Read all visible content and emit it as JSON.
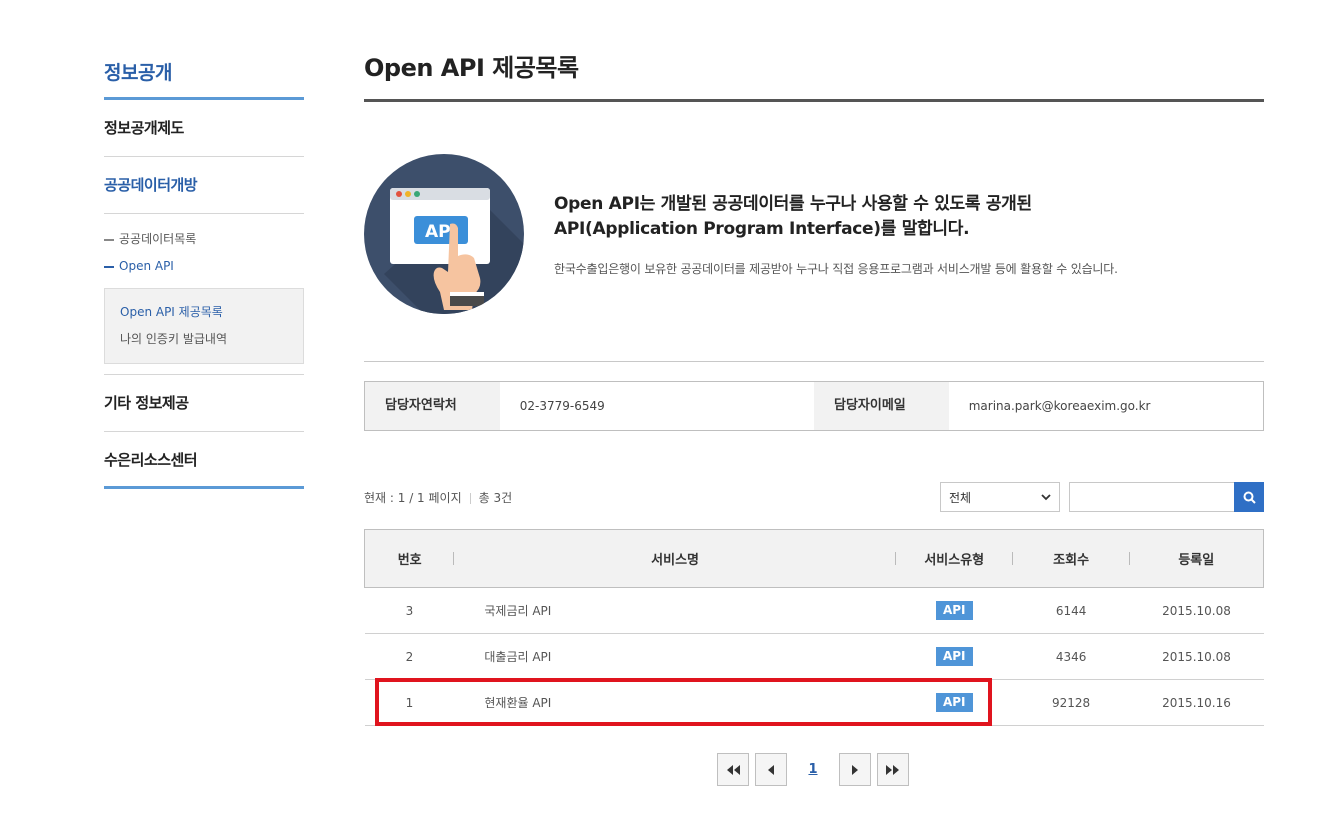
{
  "sidebar": {
    "title": "정보공개",
    "items": [
      {
        "label": "정보공개제도"
      },
      {
        "label": "공공데이터개방"
      },
      {
        "label": "기타 정보제공"
      },
      {
        "label": "수은리소스센터"
      }
    ],
    "sub_items": [
      {
        "label": "공공데이터목록"
      },
      {
        "label": "Open API"
      }
    ],
    "box_items": [
      {
        "label": "Open API 제공목록"
      },
      {
        "label": "나의 인증키 발급내역"
      }
    ]
  },
  "main": {
    "title": "Open API 제공목록",
    "intro": {
      "icon_label": "API",
      "heading_line1": "Open API는 개발된 공공데이터를 누구나 사용할 수 있도록 공개된",
      "heading_line2": "API(Application Program Interface)를 말합니다.",
      "description": "한국수출입은행이 보유한 공공데이터를 제공받아 누구나 직접 응용프로그램과 서비스개발 등에 활용할 수 있습니다."
    },
    "contact": {
      "phone_label": "담당자연락처",
      "phone_value": "02-3779-6549",
      "email_label": "담당자이메일",
      "email_value": "marina.park@koreaexim.go.kr"
    },
    "list_info": {
      "current_page": "현재 : 1 / 1 페이지",
      "total": "총 3건"
    },
    "search": {
      "select_value": "전체",
      "input_value": ""
    },
    "table": {
      "headers": [
        "번호",
        "서비스명",
        "서비스유형",
        "조회수",
        "등록일"
      ],
      "rows": [
        {
          "no": "3",
          "name": "국제금리 API",
          "type": "API",
          "views": "6144",
          "date": "2015.10.08"
        },
        {
          "no": "2",
          "name": "대출금리 API",
          "type": "API",
          "views": "4346",
          "date": "2015.10.08"
        },
        {
          "no": "1",
          "name": "현재환율 API",
          "type": "API",
          "views": "92128",
          "date": "2015.10.16"
        }
      ]
    },
    "pagination": {
      "current": "1"
    }
  },
  "colors": {
    "accent": "#2a5fa8",
    "badge": "#4f95d8",
    "highlight": "#e0141e"
  }
}
